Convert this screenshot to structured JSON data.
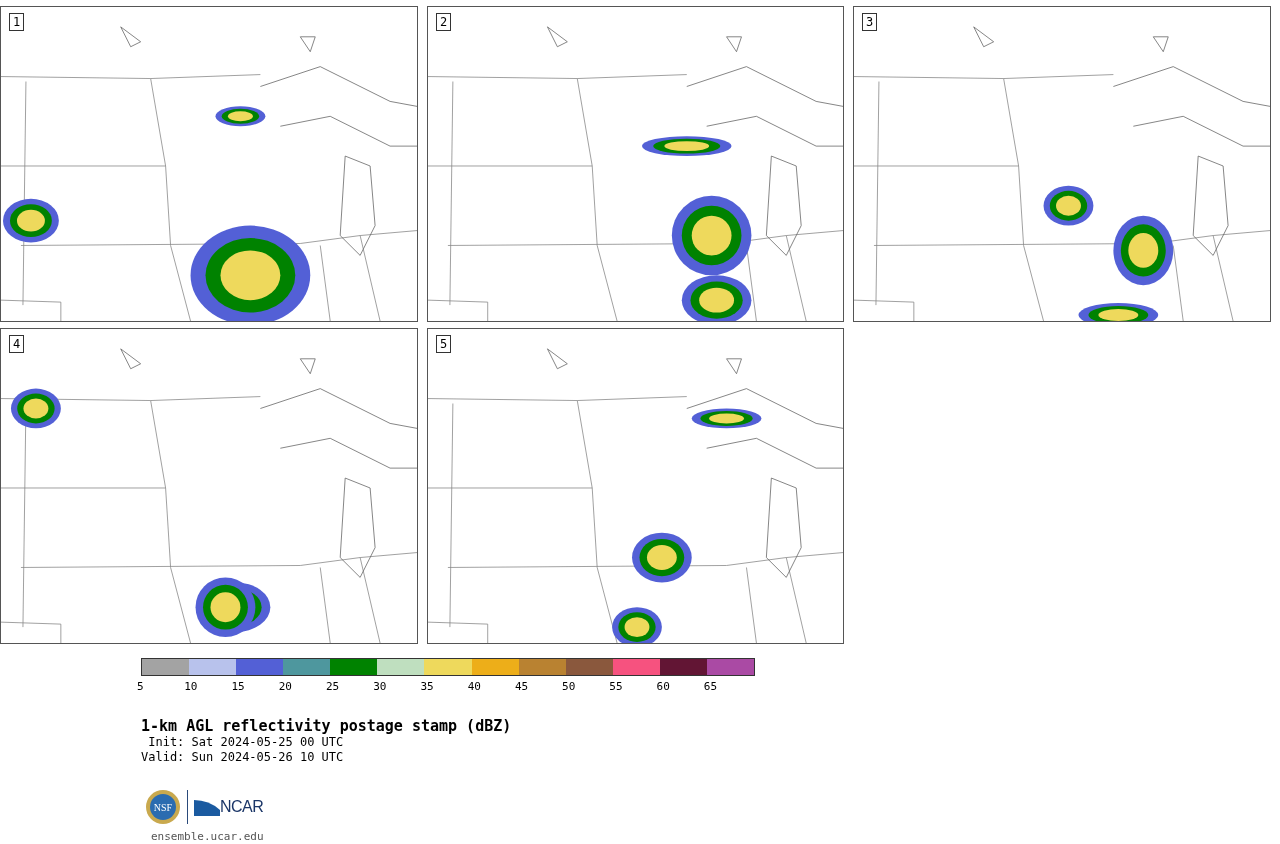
{
  "panels": [
    {
      "label": "1"
    },
    {
      "label": "2"
    },
    {
      "label": "3"
    },
    {
      "label": "4"
    },
    {
      "label": "5"
    }
  ],
  "colorbar": {
    "segments": [
      {
        "color": "#a3a3a3",
        "label": "5"
      },
      {
        "color": "#b8c2ec",
        "label": "10"
      },
      {
        "color": "#5360d6",
        "label": "15"
      },
      {
        "color": "#4e979e",
        "label": "20"
      },
      {
        "color": "#008200",
        "label": "25"
      },
      {
        "color": "#bfdfbf",
        "label": "30"
      },
      {
        "color": "#eed95c",
        "label": "35"
      },
      {
        "color": "#edae19",
        "label": "40"
      },
      {
        "color": "#b98231",
        "label": "45"
      },
      {
        "color": "#8a583d",
        "label": "50"
      },
      {
        "color": "#f6527f",
        "label": "55"
      },
      {
        "color": "#621534",
        "label": "60"
      },
      {
        "color": "#aa4aa4",
        "label": "65"
      }
    ]
  },
  "title": "1-km AGL reflectivity postage stamp (dBZ)",
  "init": " Init: Sat 2024-05-25 00 UTC",
  "valid": "Valid: Sun 2024-05-26 10 UTC",
  "logos": {
    "nsf": "NSF",
    "ncar": "NCAR"
  },
  "footer_link": "ensemble.ucar.edu"
}
